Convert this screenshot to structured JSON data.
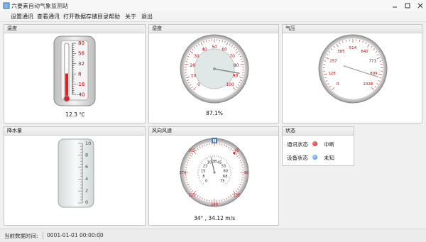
{
  "window": {
    "title": "六要素自动气象监测站"
  },
  "menu": [
    "设置通讯",
    "查看通讯",
    "打开数据存储目录",
    "帮助",
    "关于",
    "退出"
  ],
  "panels": {
    "temperature": {
      "title": "温度",
      "ticks": [
        "80",
        "56",
        "32",
        "8",
        "-16",
        "-40"
      ],
      "value": "12.3 ℃",
      "level": 0.44
    },
    "humidity": {
      "title": "湿度",
      "ticks": [
        "0",
        "10",
        "20",
        "30",
        "40",
        "50",
        "60",
        "70",
        "80",
        "90",
        "100"
      ],
      "value": "87.1%",
      "percent": 87.1
    },
    "pressure": {
      "title": "气压",
      "ticks": [
        "0",
        "128",
        "257",
        "385",
        "514",
        "642",
        "771",
        "899",
        "1028"
      ],
      "value_hpa": 925
    },
    "rainfall": {
      "title": "降水量",
      "ticks": [
        "10",
        "8",
        "6",
        "4",
        "2",
        "0"
      ]
    },
    "wind": {
      "title": "风向风速",
      "dir_ticks": [
        "0",
        "45",
        "90",
        "135",
        "180",
        "225",
        "270",
        "315"
      ],
      "speed_ticks": [
        "0",
        "8",
        "15",
        "23",
        "30",
        "38",
        "45",
        "53",
        "60",
        "68",
        "75"
      ],
      "north": "N",
      "value": "34° , 34.12 m/s",
      "direction_deg": 34,
      "speed_ms": 34.12
    },
    "status": {
      "title": "状态",
      "rows": [
        {
          "label": "通讯状态",
          "value": "中断",
          "color": "#e01a1a"
        },
        {
          "label": "设备状态",
          "value": "未知",
          "color": "#3a8ee0"
        }
      ]
    }
  },
  "statusbar": {
    "label": "当前数据时间:",
    "time": "0001-01-01 00:00:00"
  }
}
